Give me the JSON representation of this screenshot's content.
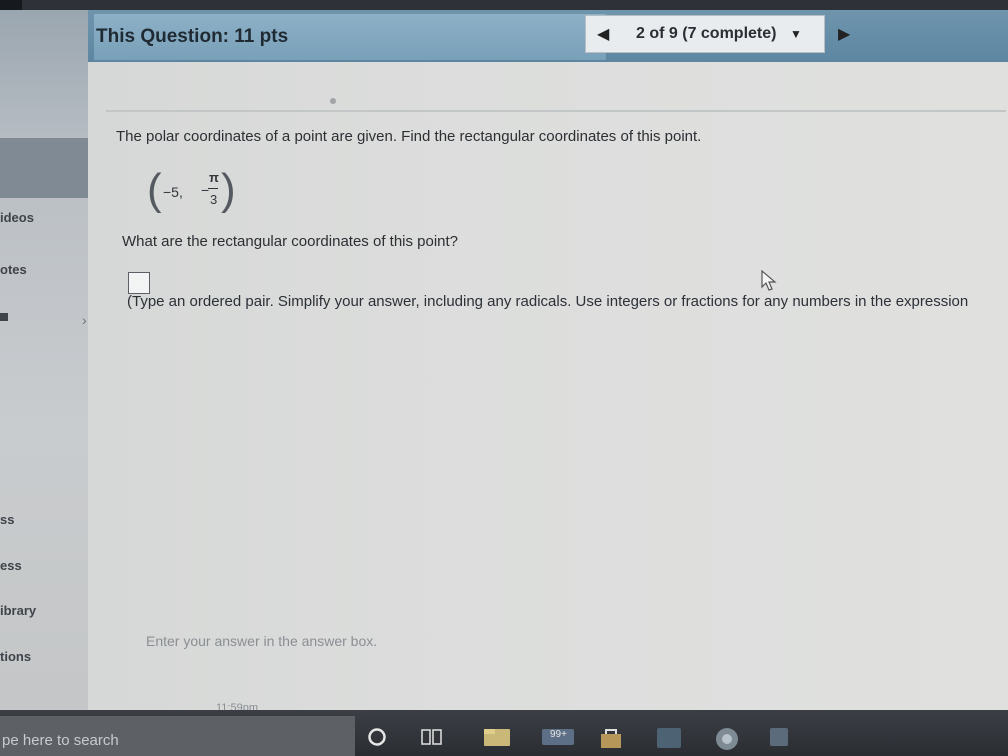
{
  "header": {
    "title": "This Question: 11 pts",
    "nav_label": "2 of 9 (7 complete)"
  },
  "sidebar": {
    "items": [
      {
        "label": "ideos"
      },
      {
        "label": "otes"
      },
      {
        "label": "ss"
      },
      {
        "label": "ess"
      },
      {
        "label": "ibrary"
      },
      {
        "label": "tions"
      }
    ]
  },
  "problem": {
    "statement": "The polar coordinates of a point are given. Find the rectangular coordinates of this point.",
    "point_r": "−5,",
    "point_theta_sign": "−",
    "point_theta_numerator": "π",
    "point_theta_denominator": "3",
    "question": "What are the rectangular coordinates of this point?",
    "instructions": "(Type an ordered pair. Simplify your answer, including any radicals. Use integers or fractions for any numbers in the expression",
    "hint": "Enter your answer in the answer box.",
    "answer_value": ""
  },
  "status": {
    "clock": "11:59pm"
  },
  "taskbar": {
    "search_placeholder": "pe here to search",
    "mail_badge": "99+"
  },
  "icons": [
    "cortana-icon",
    "task-view-icon",
    "file-explorer-icon",
    "mail-icon",
    "store-icon",
    "app-icon",
    "chrome-icon",
    "word-icon"
  ],
  "colors": {
    "header": "#6a90a9",
    "content_bg": "#dcdddc",
    "taskbar": "#2f3237"
  }
}
